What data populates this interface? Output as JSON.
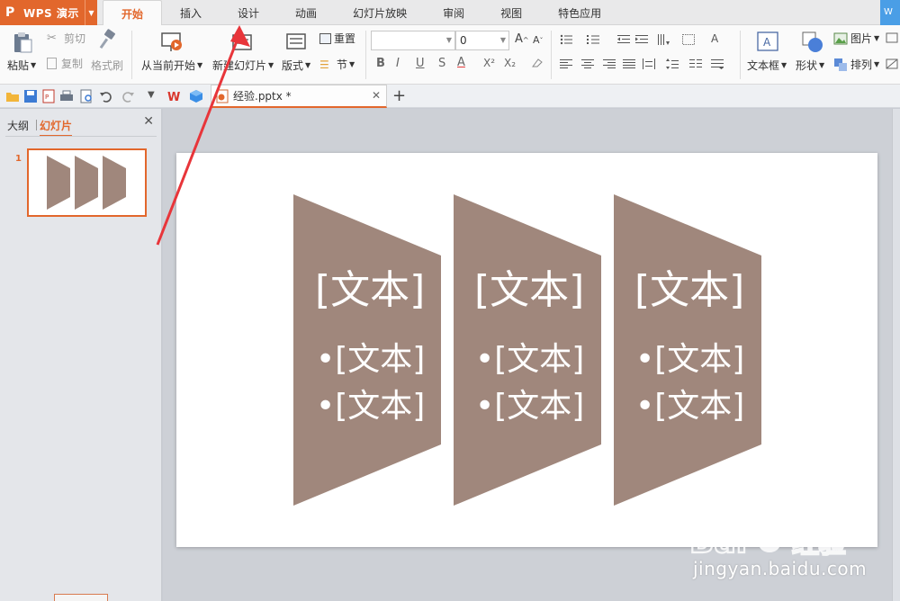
{
  "app": {
    "name": "WPS 演示",
    "logo": "P"
  },
  "tabs": [
    "开始",
    "插入",
    "设计",
    "动画",
    "幻灯片放映",
    "审阅",
    "视图",
    "特色应用"
  ],
  "active_tab": "开始",
  "corner_badge": "W",
  "ribbon": {
    "paste": "粘贴",
    "cut": "剪切",
    "copy": "复制",
    "format_painter": "格式刷",
    "from_current": "从当前开始",
    "new_slide": "新建幻灯片",
    "layout": "版式",
    "reset": "重置",
    "section": "节",
    "font_name": "",
    "font_size": "0",
    "bold": "B",
    "italic": "I",
    "underline": "U",
    "strike": "S",
    "font_color": "A",
    "superscript": "X²",
    "subscript": "X₂",
    "text_box": "文本框",
    "shape": "形状",
    "picture": "图片",
    "arrange": "排列"
  },
  "quickbar": {
    "doc_tab": "经验.pptx *"
  },
  "left_panel": {
    "outline_tab": "大纲",
    "slides_tab": "幻灯片",
    "slide_number": "1"
  },
  "slide": {
    "shapes": [
      {
        "title": "[文本]",
        "bullets": [
          "[文本]",
          "[文本]"
        ]
      },
      {
        "title": "[文本]",
        "bullets": [
          "[文本]",
          "[文本]"
        ]
      },
      {
        "title": "[文本]",
        "bullets": [
          "[文本]",
          "[文本]"
        ]
      }
    ],
    "shape_color": "#a0877c"
  },
  "watermark": {
    "brand": "Baidu经验",
    "site": "jingyan.baidu.com"
  },
  "colors": {
    "accent": "#e2672c",
    "annotation_arrow": "#e8353a"
  }
}
